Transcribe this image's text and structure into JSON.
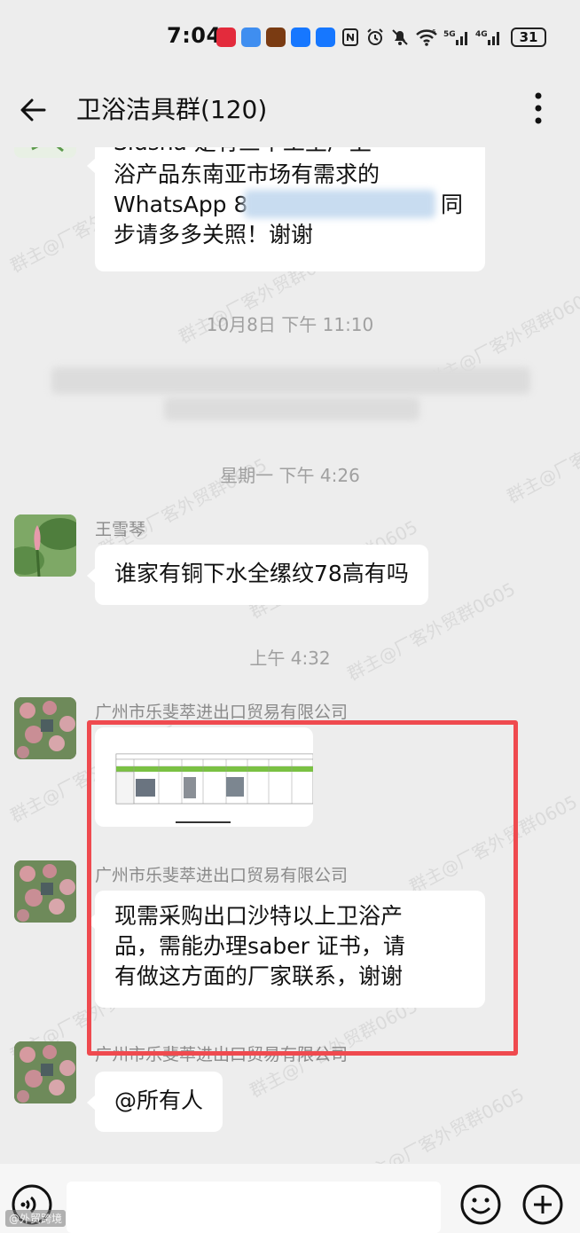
{
  "status_bar": {
    "time": "7:04",
    "net_6": "6",
    "net_5g": "5G",
    "net_4g": "4G",
    "battery": "31"
  },
  "header": {
    "title": "卫浴洁具群(120)"
  },
  "messages": {
    "m1_lines": [
      "Sidsha 是有三个工生产卫",
      "浴产品东南亚市场有需求的",
      "WhatsApp 8",
      "步请多多关照！谢谢"
    ],
    "m1_suffix": "同",
    "ts1": "10月8日  下午 11:10",
    "ts2": "星期一  下午 4:26",
    "m2_sender": "王雪琴",
    "m2_text": "谁家有铜下水全缧纹78高有吗",
    "ts3": "上午 4:32",
    "m3_sender": "广州市乐斐萃进出口贸易有限公司",
    "m4_sender": "广州市乐斐萃进出口贸易有限公司",
    "m4_lines": [
      "现需采购出口沙特以上卫浴产",
      "品，需能办理saber 证书，请",
      "有做这方面的厂家联系，谢谢"
    ],
    "m5_sender": "广州市乐斐萃进出口贸易有限公司",
    "m5_text": "@所有人"
  },
  "watermark": "群主@厂客外贸群0605",
  "corner_mark": "@外贸跨境",
  "colors": {
    "background": "#ededed",
    "bubble": "#ffffff",
    "highlight_box": "#ef4a4f",
    "timestamp": "#a0a0a0"
  }
}
